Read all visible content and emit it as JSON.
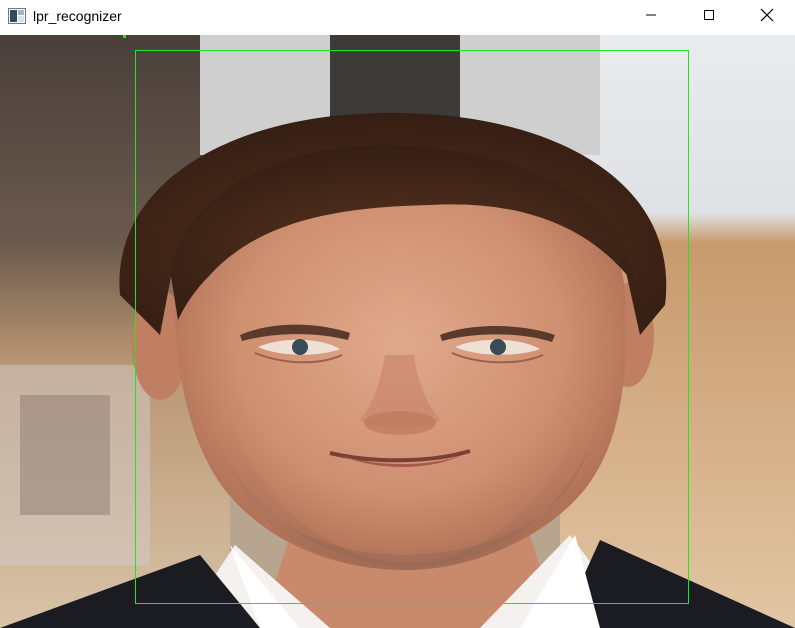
{
  "window": {
    "title": "lpr_recognizer",
    "icon": "app-window-icon",
    "controls": {
      "minimize_icon": "minimize-icon",
      "maximize_icon": "maximize-icon",
      "close_icon": "close-icon"
    }
  },
  "image": {
    "description_icon": "face-photo",
    "detection": {
      "color": "#22e51f"
    }
  },
  "colors": {
    "titlebar_bg": "#ffffff",
    "detection_box": "#22e51f",
    "close_hover": "#e81123"
  }
}
